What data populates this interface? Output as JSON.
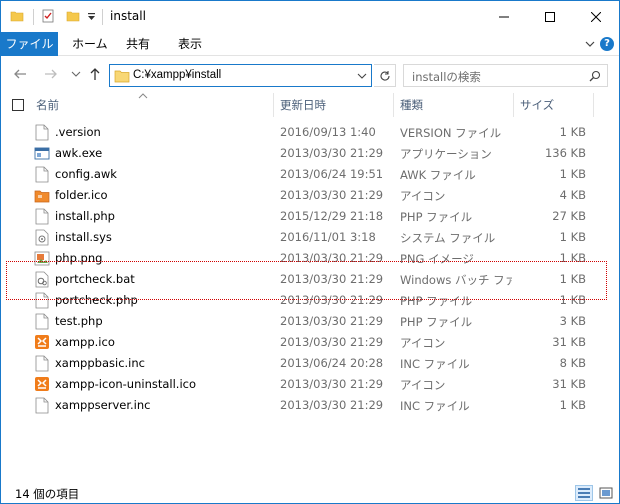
{
  "window": {
    "title": "install",
    "colors": {
      "accent": "#1979ca",
      "text_gray": "#6d6d6d",
      "header_text": "#4c607a",
      "highlight": "#d00000"
    }
  },
  "ribbon": {
    "tabs": [
      {
        "label": "ファイル",
        "active": true
      },
      {
        "label": "ホーム"
      },
      {
        "label": "共有"
      },
      {
        "label": "表示"
      }
    ],
    "help_label": "?"
  },
  "nav": {
    "address": "C:¥xampp¥install",
    "search_placeholder": "installの検索"
  },
  "columns": {
    "name": "名前",
    "date": "更新日時",
    "type": "種類",
    "size": "サイズ"
  },
  "files": [
    {
      "name": ".version",
      "date": "2016/09/13 1:40",
      "type": "VERSION ファイル",
      "size": "1 KB",
      "icon": "doc-icon"
    },
    {
      "name": "awk.exe",
      "date": "2013/03/30 21:29",
      "type": "アプリケーション",
      "size": "136 KB",
      "icon": "exe-icon"
    },
    {
      "name": "config.awk",
      "date": "2013/06/24 19:51",
      "type": "AWK ファイル",
      "size": "1 KB",
      "icon": "doc-icon"
    },
    {
      "name": "folder.ico",
      "date": "2013/03/30 21:29",
      "type": "アイコン",
      "size": "4 KB",
      "icon": "folder-ico-icon"
    },
    {
      "name": "install.php",
      "date": "2015/12/29 21:18",
      "type": "PHP ファイル",
      "size": "27 KB",
      "icon": "doc-icon"
    },
    {
      "name": "install.sys",
      "date": "2016/11/01 3:18",
      "type": "システム ファイル",
      "size": "1 KB",
      "icon": "sys-icon"
    },
    {
      "name": "php.png",
      "date": "2013/03/30 21:29",
      "type": "PNG イメージ",
      "size": "1 KB",
      "icon": "png-icon"
    },
    {
      "name": "portcheck.bat",
      "date": "2013/03/30 21:29",
      "type": "Windows バッチ ファ...",
      "size": "1 KB",
      "icon": "bat-icon"
    },
    {
      "name": "portcheck.php",
      "date": "2013/03/30 21:29",
      "type": "PHP ファイル",
      "size": "1 KB",
      "icon": "doc-icon"
    },
    {
      "name": "test.php",
      "date": "2013/03/30 21:29",
      "type": "PHP ファイル",
      "size": "3 KB",
      "icon": "doc-icon"
    },
    {
      "name": "xampp.ico",
      "date": "2013/03/30 21:29",
      "type": "アイコン",
      "size": "31 KB",
      "icon": "xampp-icon"
    },
    {
      "name": "xamppbasic.inc",
      "date": "2013/06/24 20:28",
      "type": "INC ファイル",
      "size": "8 KB",
      "icon": "doc-icon"
    },
    {
      "name": "xampp-icon-uninstall.ico",
      "date": "2013/03/30 21:29",
      "type": "アイコン",
      "size": "31 KB",
      "icon": "xampp-icon"
    },
    {
      "name": "xamppserver.inc",
      "date": "2013/03/30 21:29",
      "type": "INC ファイル",
      "size": "1 KB",
      "icon": "doc-icon"
    }
  ],
  "status": {
    "count_text": "14 個の項目"
  }
}
